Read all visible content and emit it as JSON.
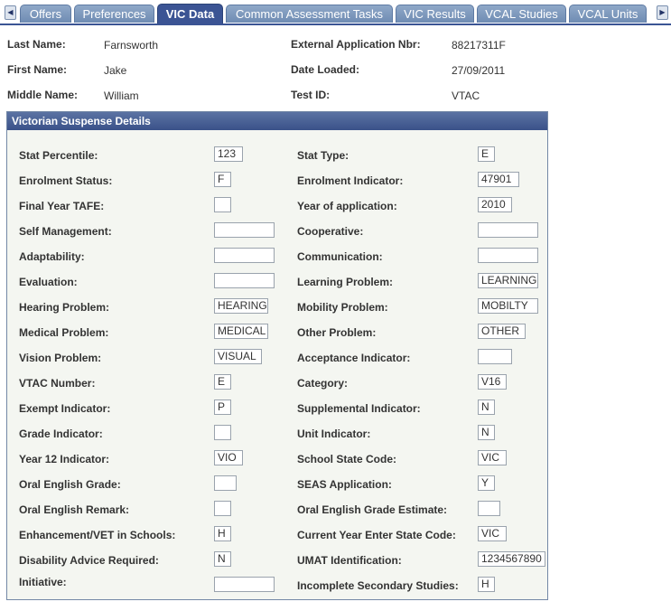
{
  "tabs": [
    "Offers",
    "Preferences",
    "VIC Data",
    "Common Assessment Tasks",
    "VIC Results",
    "VCAL Studies",
    "VCAL Units"
  ],
  "active_tab": "VIC Data",
  "header": {
    "last_name_label": "Last Name:",
    "last_name": "Farnsworth",
    "first_name_label": "First Name:",
    "first_name": "Jake",
    "middle_name_label": "Middle Name:",
    "middle_name": "William",
    "ext_app_label": "External Application Nbr:",
    "ext_app": "88217311F",
    "date_loaded_label": "Date Loaded:",
    "date_loaded": "27/09/2011",
    "test_id_label": "Test ID:",
    "test_id": "VTAC"
  },
  "group_title": "Victorian Suspense Details",
  "fields": [
    {
      "left_label": "Stat Percentile:",
      "left_value": "123",
      "right_label": "Stat Type:",
      "right_value": "E"
    },
    {
      "left_label": "Enrolment Status:",
      "left_value": "F",
      "right_label": "Enrolment Indicator:",
      "right_value": "47901"
    },
    {
      "left_label": "Final Year TAFE:",
      "left_value": "",
      "right_label": "Year of application:",
      "right_value": "2010"
    },
    {
      "left_label": "Self Management:",
      "left_value": "",
      "right_label": "Cooperative:",
      "right_value": ""
    },
    {
      "left_label": "Adaptability:",
      "left_value": "",
      "right_label": "Communication:",
      "right_value": ""
    },
    {
      "left_label": "Evaluation:",
      "left_value": "",
      "right_label": "Learning Problem:",
      "right_value": "LEARNING"
    },
    {
      "left_label": "Hearing Problem:",
      "left_value": "HEARING",
      "right_label": "Mobility Problem:",
      "right_value": "MOBILTY"
    },
    {
      "left_label": "Medical Problem:",
      "left_value": "MEDICAL",
      "right_label": "Other Problem:",
      "right_value": "OTHER"
    },
    {
      "left_label": "Vision Problem:",
      "left_value": "VISUAL",
      "right_label": "Acceptance Indicator:",
      "right_value": ""
    },
    {
      "left_label": "VTAC Number:",
      "left_value": "E",
      "right_label": "Category:",
      "right_value": "V16"
    },
    {
      "left_label": "Exempt Indicator:",
      "left_value": "P",
      "right_label": "Supplemental Indicator:",
      "right_value": "N"
    },
    {
      "left_label": "Grade Indicator:",
      "left_value": "",
      "right_label": "Unit Indicator:",
      "right_value": "N"
    },
    {
      "left_label": "Year 12 Indicator:",
      "left_value": "VIO",
      "right_label": "School State Code:",
      "right_value": "VIC"
    },
    {
      "left_label": "Oral English Grade:",
      "left_value": "",
      "right_label": "SEAS Application:",
      "right_value": "Y"
    },
    {
      "left_label": "Oral English Remark:",
      "left_value": "",
      "right_label": "Oral English Grade Estimate:",
      "right_value": ""
    },
    {
      "left_label": "Enhancement/VET in Schools:",
      "left_value": "H",
      "right_label": "Current Year Enter State Code:",
      "right_value": "VIC"
    },
    {
      "left_label": "Disability Advice Required:",
      "left_value": "N",
      "right_label": "UMAT Identification:",
      "right_value": "1234567890"
    },
    {
      "left_label": "Initiative:",
      "left_value": "",
      "right_label": "Incomplete Secondary Studies:",
      "right_value": "H"
    }
  ],
  "icons": {
    "scroll_left": "left-arrow-icon",
    "scroll_right": "right-arrow-icon"
  },
  "colors": {
    "tab_active": "#3b5494",
    "tab_inactive": "#7f9ac0",
    "group_header": "#3f5690",
    "group_bg": "#f4f6f1"
  }
}
